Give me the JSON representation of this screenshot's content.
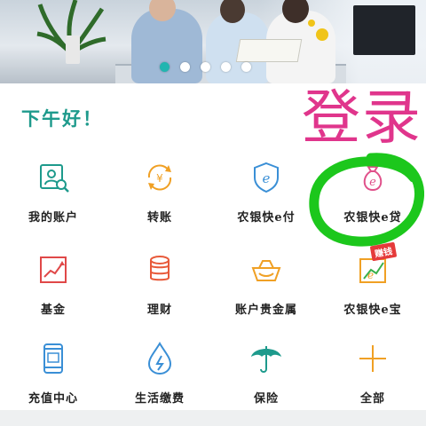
{
  "banner": {
    "slide_count": 5,
    "active_slide": 1
  },
  "greeting": "下午好！",
  "handwriting_annotation": "登录",
  "hot_badge": "赚钱",
  "menu": [
    {
      "label": "我的账户",
      "icon": "account-search-icon",
      "color": "#1d9a8c"
    },
    {
      "label": "转账",
      "icon": "transfer-yuan-icon",
      "color": "#f0a024"
    },
    {
      "label": "农银快e付",
      "icon": "e-pay-shield-icon",
      "color": "#3a8fd6"
    },
    {
      "label": "农银快e贷",
      "icon": "e-loan-bag-icon",
      "color": "#e0508a"
    },
    {
      "label": "基金",
      "icon": "fund-chart-icon",
      "color": "#e04848"
    },
    {
      "label": "理财",
      "icon": "wealth-coins-icon",
      "color": "#e85a3a"
    },
    {
      "label": "账户贵金属",
      "icon": "gold-ingot-icon",
      "color": "#f0a024"
    },
    {
      "label": "农银快e宝",
      "icon": "e-bao-chart-icon",
      "color": "#f0a024"
    },
    {
      "label": "充值中心",
      "icon": "phone-recharge-icon",
      "color": "#3a8fd6"
    },
    {
      "label": "生活缴费",
      "icon": "utility-drop-icon",
      "color": "#3a8fd6"
    },
    {
      "label": "保险",
      "icon": "umbrella-icon",
      "color": "#1d9a8c"
    },
    {
      "label": "全部",
      "icon": "plus-icon",
      "color": "#f0a024"
    }
  ],
  "colors": {
    "greeting": "#1e9a8c",
    "annotation_text": "#e0358c",
    "annotation_circle": "#1cc71c",
    "active_dot": "#22b5b0"
  }
}
